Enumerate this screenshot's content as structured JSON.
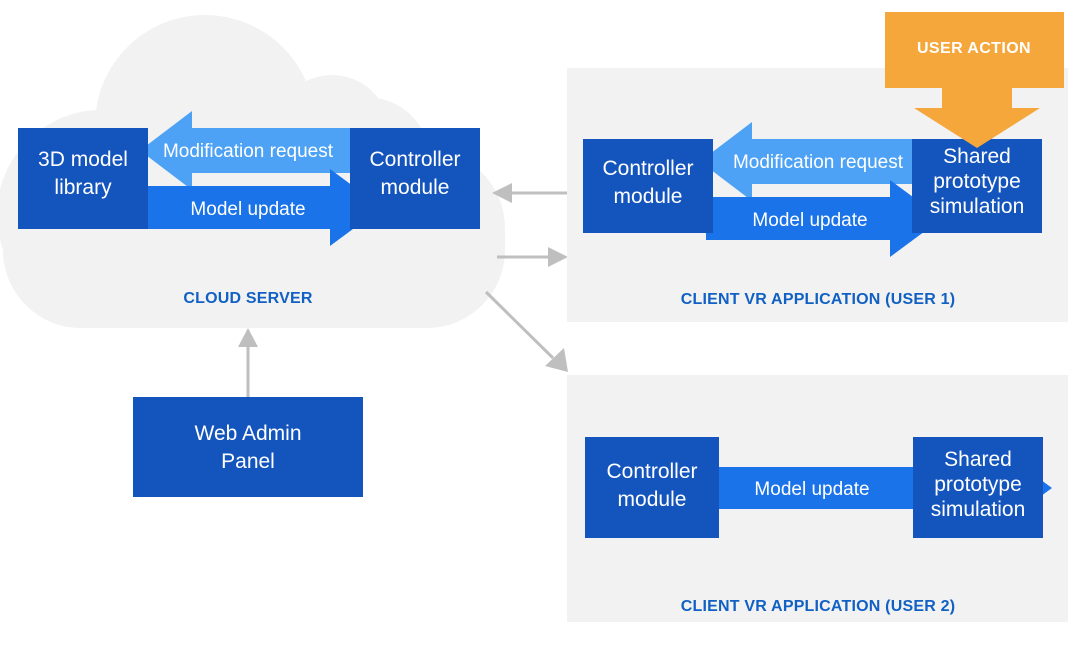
{
  "diagram": {
    "title_visible": false,
    "colors": {
      "dark_blue": "#1455bd",
      "mid_blue": "#1a73e8",
      "light_blue": "#4da2f5",
      "orange": "#f5a73b",
      "panel_gray": "#f2f2f2",
      "cloud_gray": "#f2f2f2",
      "connector_gray": "#bfbfbf",
      "label_blue": "#1160c4",
      "white": "#ffffff"
    },
    "cloud": {
      "label": "CLOUD SERVER",
      "boxes": [
        {
          "id": "model-library",
          "label_line1": "3D model",
          "label_line2": "library"
        },
        {
          "id": "controller-module",
          "label_line1": "Controller",
          "label_line2": "module"
        }
      ],
      "arrows": [
        {
          "id": "modification-request",
          "label": "Modification request",
          "direction": "left",
          "color": "light_blue"
        },
        {
          "id": "model-update",
          "label": "Model update",
          "direction": "right",
          "color": "mid_blue"
        }
      ]
    },
    "web_admin": {
      "id": "web-admin-panel",
      "label_line1": "Web Admin",
      "label_line2": "Panel"
    },
    "user_action": {
      "id": "user-action",
      "label": "USER ACTION"
    },
    "client_panels": [
      {
        "id": "client-vr-user-1",
        "label": "CLIENT VR APPLICATION (USER 1)",
        "boxes": [
          {
            "id": "controller-module-u1",
            "lines": [
              "Controller",
              "module"
            ]
          },
          {
            "id": "shared-prototype-u1",
            "lines": [
              "Shared",
              "prototype",
              "simulation"
            ]
          }
        ],
        "arrows": [
          {
            "id": "modification-request-u1",
            "label": "Modification request",
            "direction": "left",
            "color": "light_blue"
          },
          {
            "id": "model-update-u1",
            "label": "Model update",
            "direction": "right",
            "color": "mid_blue"
          }
        ]
      },
      {
        "id": "client-vr-user-2",
        "label": "CLIENT VR APPLICATION (USER 2)",
        "boxes": [
          {
            "id": "controller-module-u2",
            "lines": [
              "Controller",
              "module"
            ]
          },
          {
            "id": "shared-prototype-u2",
            "lines": [
              "Shared",
              "prototype",
              "simulation"
            ]
          }
        ],
        "arrows": [
          {
            "id": "model-update-u2",
            "label": "Model update",
            "direction": "right",
            "color": "mid_blue"
          }
        ]
      }
    ],
    "connectors": [
      {
        "id": "connector-user1-to-cloud",
        "direction": "left",
        "from": "client-vr-user-1",
        "to": "cloud"
      },
      {
        "id": "connector-cloud-to-user1",
        "direction": "right",
        "from": "cloud",
        "to": "client-vr-user-1"
      },
      {
        "id": "connector-cloud-to-user2",
        "direction": "down-right",
        "from": "cloud",
        "to": "client-vr-user-2"
      },
      {
        "id": "connector-webadmin-to-cloud",
        "direction": "up",
        "from": "web-admin-panel",
        "to": "cloud"
      }
    ]
  }
}
